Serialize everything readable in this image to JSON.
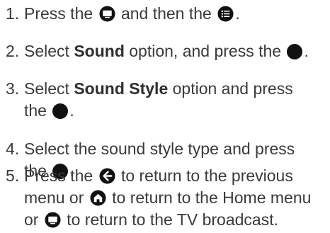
{
  "steps": [
    {
      "number": "1.",
      "t1": "Press the",
      "t2": "and then the",
      "t3": "."
    },
    {
      "number": "2.",
      "t1": "Select",
      "bold": "Sound",
      "t2": "option, and press the",
      "t3": "."
    },
    {
      "number": "3.",
      "t1": "Select",
      "bold": "Sound Style",
      "t2": "option and press",
      "t3": "the",
      "t4": "."
    },
    {
      "number": "4.",
      "t1": "Select the sound style type and press",
      "t2": "the",
      "t3": "."
    },
    {
      "number": "5.",
      "t1": "Press the",
      "t2": "to return to the previous",
      "t3": "menu or",
      "t4": "to return to the Home menu",
      "t5": "or",
      "t6": "to return to the TV broadcast."
    }
  ],
  "icons": {
    "tv_button": "tv-button-icon",
    "settings_button": "settings-list-icon",
    "ok_button": "ok-dot-icon",
    "back_button": "back-arrow-icon",
    "home_button": "home-icon"
  },
  "colors": {
    "text": "#3a3a3a",
    "icon": "#111111"
  }
}
